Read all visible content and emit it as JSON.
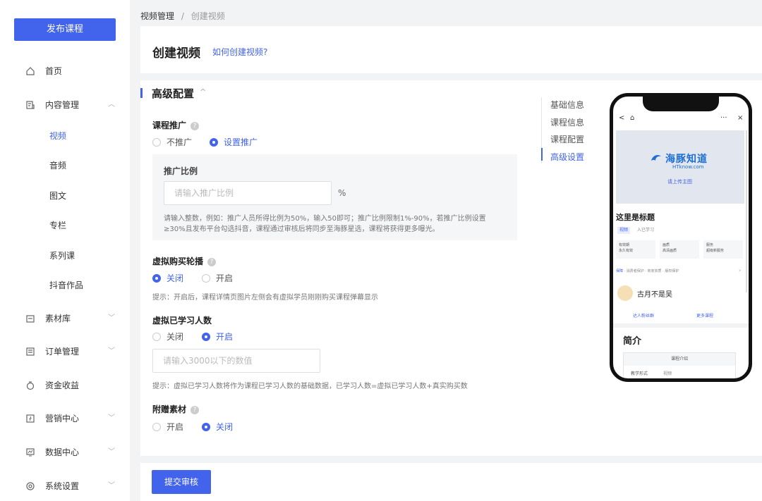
{
  "sidebar": {
    "publish_label": "发布课程",
    "items": [
      {
        "label": "首页",
        "icon": "home-icon"
      },
      {
        "label": "内容管理",
        "icon": "content-icon"
      },
      {
        "label": "素材库",
        "icon": "folder-icon"
      },
      {
        "label": "订单管理",
        "icon": "order-icon"
      },
      {
        "label": "资金收益",
        "icon": "money-icon"
      },
      {
        "label": "营销中心",
        "icon": "marketing-icon"
      },
      {
        "label": "数据中心",
        "icon": "chart-icon"
      },
      {
        "label": "系统设置",
        "icon": "settings-icon"
      }
    ],
    "sub_items": [
      "视频",
      "音频",
      "图文",
      "专栏",
      "系列课",
      "抖音作品"
    ]
  },
  "breadcrumb": {
    "parent": "视频管理",
    "sep": "/",
    "current": "创建视频"
  },
  "header": {
    "title": "创建视频",
    "help_link": "如何创建视频?"
  },
  "section": {
    "title": "高级配置",
    "caret": "^"
  },
  "course_promo": {
    "label": "课程推广",
    "options": [
      "不推广",
      "设置推广"
    ],
    "selected": "设置推广",
    "ratio_label": "推广比例",
    "ratio_placeholder": "请输入推广比例",
    "ratio_unit": "%",
    "hint": "请输入整数，例如：推广人员所得比例为50%，输入50即可；推广比例限制1%-90%，若推广比例设置≥30%且发布平台勾选抖音，课程通过审核后将同步至海豚星选，课程将获得更多曝光。"
  },
  "virtual_purchase": {
    "label": "虚拟购买轮播",
    "options": [
      "关闭",
      "开启"
    ],
    "selected": "关闭",
    "hint": "提示：开启后，课程详情页图片左侧会有虚拟学员刚刚购买课程弹幕显示"
  },
  "virtual_learners": {
    "label": "虚拟已学习人数",
    "options": [
      "关闭",
      "开启"
    ],
    "selected": "开启",
    "placeholder": "请输入3000以下的数值",
    "hint": "提示：虚拟已学习人数将作为课程已学习人数的基础数据，已学习人数=虚拟已学习人数+真实购买数"
  },
  "gift_material": {
    "label": "附赠素材",
    "options": [
      "开启",
      "关闭"
    ],
    "selected": "关闭"
  },
  "anchors": {
    "items": [
      "基础信息",
      "课程信息",
      "课程配置",
      "高级设置"
    ],
    "active": "高级设置"
  },
  "footer": {
    "submit_label": "提交审核"
  },
  "phone": {
    "back": "<",
    "more": "···",
    "close": "×",
    "logo_text": "海豚知道",
    "logo_sub": "HTknow.com",
    "upload_text": "请上传主图",
    "title": "这里是标题",
    "tag": "视频",
    "tag2": "入已学习",
    "features": [
      {
        "top": "有效期",
        "bottom": "永久有效"
      },
      {
        "top": "画质",
        "bottom": "高清画质"
      },
      {
        "top": "服务",
        "bottom": "超级新服务"
      }
    ],
    "guard_label": "保障",
    "guard_text": "· 消费者保护 · 商家资质 · 版权保护",
    "author": "古月不是吴",
    "link_left": "达人粉丝群",
    "link_right": "更多课程",
    "intro_title": "简介",
    "table_header": "课程介绍",
    "table_c1": "教学形式",
    "table_c2": "视频"
  },
  "colors": {
    "accent": "#4263eb"
  }
}
